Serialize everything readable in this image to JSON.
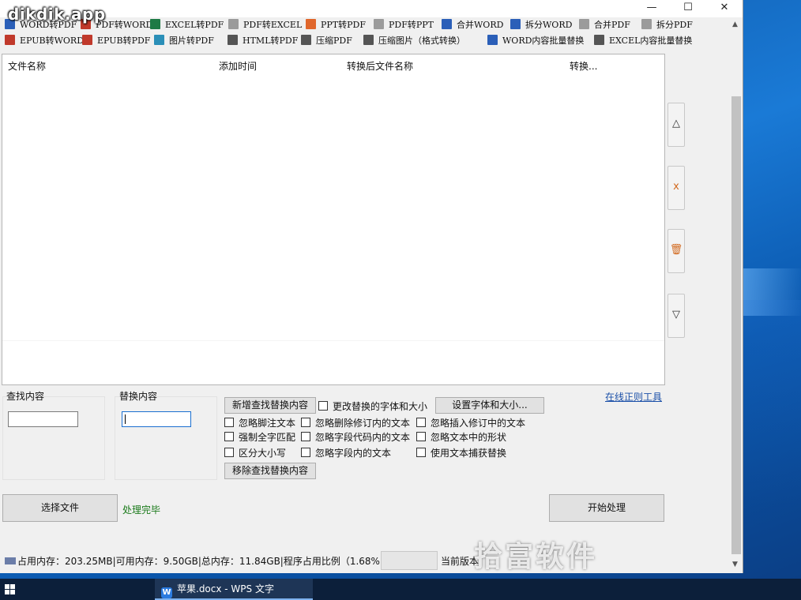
{
  "brand": "dikdik.app",
  "window_controls": {
    "minimize": "—",
    "maximize": "☐",
    "close": "✕"
  },
  "toolbar": {
    "row1": [
      {
        "label": "WORD转PDF",
        "icon": "word-icon",
        "color": "#2b5fb8"
      },
      {
        "label": "PDF转WORD",
        "icon": "pdf-icon",
        "color": "#c0392b"
      },
      {
        "label": "EXCEL转PDF",
        "icon": "excel-icon",
        "color": "#1e7a45"
      },
      {
        "label": "PDF转EXCEL",
        "icon": "pdf-icon",
        "color": "#c0392b"
      },
      {
        "label": "PPT转PDF",
        "icon": "ppt-icon",
        "color": "#e0662b"
      },
      {
        "label": "PDF转PPT",
        "icon": "pdf-icon",
        "color": "#c0392b"
      },
      {
        "label": "合并WORD",
        "icon": "merge-icon",
        "color": "#2b5fb8"
      },
      {
        "label": "拆分WORD",
        "icon": "split-icon",
        "color": "#2b5fb8"
      },
      {
        "label": "合并PDF",
        "icon": "merge-icon",
        "color": "#c0392b"
      },
      {
        "label": "拆分PDF",
        "icon": "split-icon",
        "color": "#c0392b"
      }
    ],
    "row2": [
      {
        "label": "EPUB转WORD",
        "icon": "epub-icon",
        "color": "#c0392b"
      },
      {
        "label": "EPUB转PDF",
        "icon": "epub-icon",
        "color": "#c0392b"
      },
      {
        "label": "图片转PDF",
        "icon": "image-icon",
        "color": "#2b8fb8"
      },
      {
        "label": "HTML转PDF",
        "icon": "html-icon",
        "color": "#555555"
      },
      {
        "label": "压缩PDF",
        "icon": "compress-icon",
        "color": "#555555"
      },
      {
        "label": "压缩图片（格式转换）",
        "icon": "compress-icon",
        "color": "#555555"
      },
      {
        "label": "WORD内容批量替换",
        "icon": "word-icon",
        "color": "#2b5fb8"
      },
      {
        "label": "EXCEL内容批量替换",
        "icon": "excel-icon",
        "color": "#1e7a45"
      }
    ]
  },
  "file_list": {
    "columns": [
      "文件名称",
      "添加时间",
      "转换后文件名称",
      "转换..."
    ]
  },
  "side_buttons": {
    "up": "△",
    "delete": "x",
    "clear": "🗑",
    "down": "▽"
  },
  "find": {
    "label": "查找内容",
    "value": ""
  },
  "replace": {
    "label": "替换内容",
    "value": ""
  },
  "buttons": {
    "add_find_replace": "新增查找替换内容",
    "set_font": "设置字体和大小...",
    "remove_find_replace": "移除查找替换内容",
    "select_file": "选择文件",
    "start": "开始处理"
  },
  "checkboxes": {
    "change_font": "更改替换的字体和大小",
    "ignore_footnote": "忽略脚注文本",
    "ignore_deleted_revision": "忽略删除修订内的文本",
    "ignore_inserted_revision": "忽略插入修订中的文本",
    "force_whole_word": "强制全字匹配",
    "ignore_field_code": "忽略字段代码内的文本",
    "ignore_shape_text": "忽略文本中的形状",
    "case_sensitive": "区分大小写",
    "ignore_field_text": "忽略字段内的文本",
    "use_text_capture": "使用文本捕获替换"
  },
  "online_regex_link": "在线正则工具",
  "status": "处理完毕",
  "memory_text": "占用内存：203.25MB|可用内存：9.50GB|总内存：11.84GB|程序占用比例（1.68%)",
  "version_text": "当前版本",
  "watermark": "拾富软件",
  "taskbar": {
    "task_label": "苹果.docx - WPS 文字"
  }
}
